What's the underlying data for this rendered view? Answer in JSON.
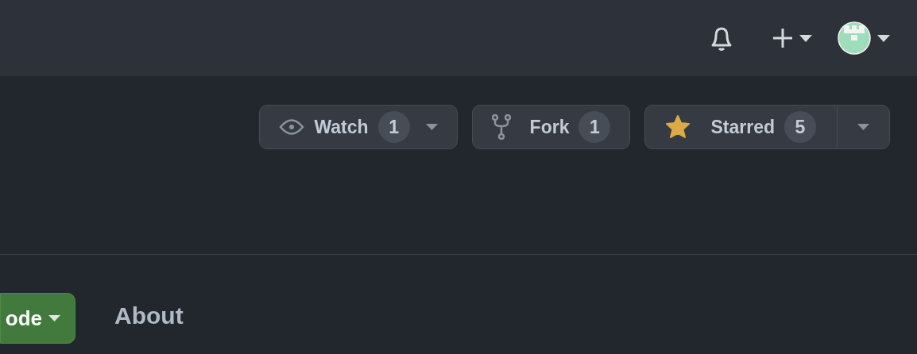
{
  "repo_actions": [
    {
      "kind": "watch",
      "label": "Watch",
      "count": "1"
    },
    {
      "kind": "fork",
      "label": "Fork",
      "count": "1"
    },
    {
      "kind": "star",
      "label": "Starred",
      "count": "5",
      "starred": true
    }
  ],
  "code_button": {
    "label": "ode"
  },
  "about": {
    "title": "About"
  }
}
